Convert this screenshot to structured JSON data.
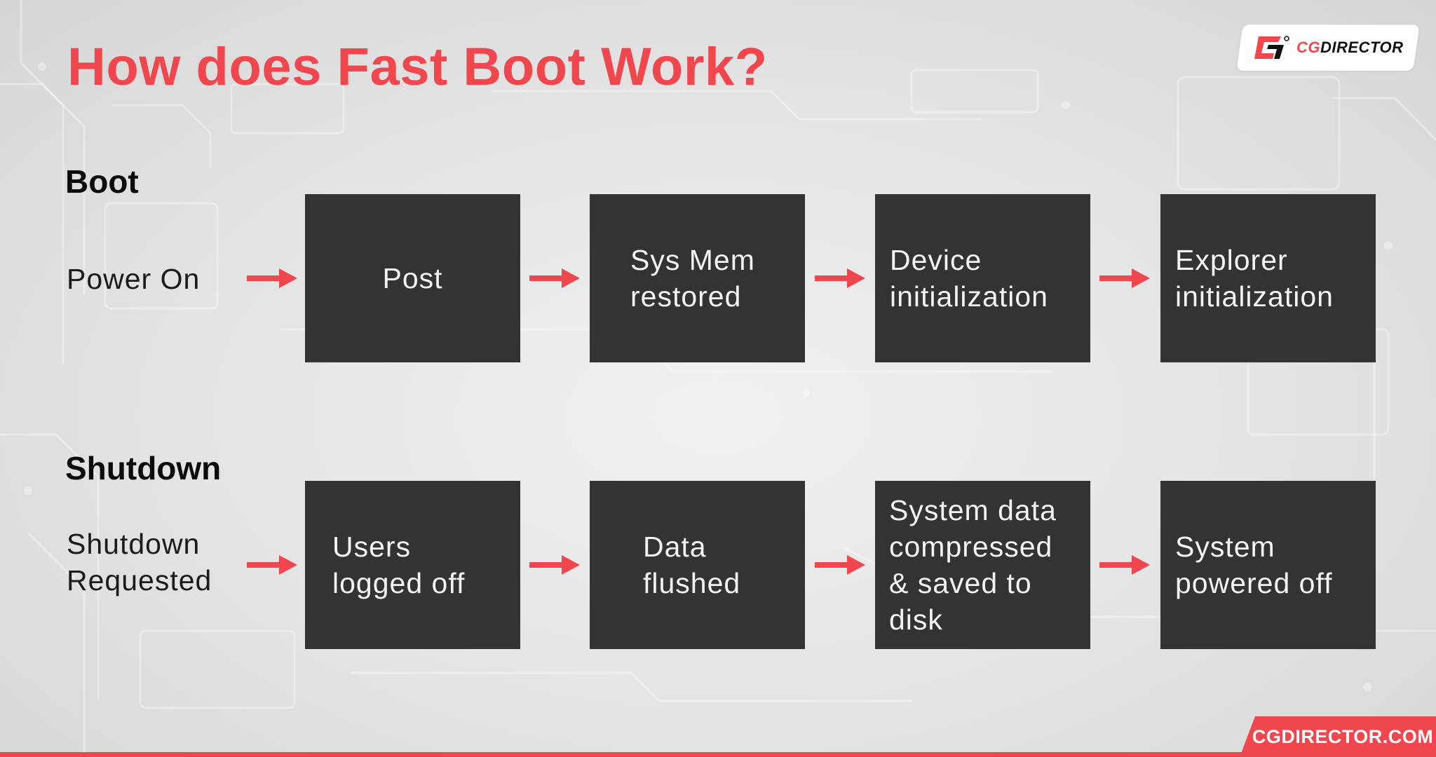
{
  "title": "How does Fast Boot Work?",
  "logo": {
    "mark": "cg-logo-mark",
    "text_accent": "CG",
    "text_main": "DIRECTOR"
  },
  "colors": {
    "accent": "#f0474f",
    "box": "#333333",
    "box_text": "#f3f3f3"
  },
  "boot": {
    "label": "Boot",
    "start": "Power On",
    "steps": [
      "Post",
      "Sys Mem\nrestored",
      "Device\ninitialization",
      "Explorer\ninitialization"
    ]
  },
  "shutdown": {
    "label": "Shutdown",
    "start": "Shutdown\nRequested",
    "steps": [
      "Users\nlogged off",
      "Data\nflushed",
      "System data\ncompressed\n& saved to\ndisk",
      "System\npowered off"
    ]
  },
  "arrow_icon": "arrow-right-icon",
  "footer": {
    "site": "CGDIRECTOR.COM"
  }
}
